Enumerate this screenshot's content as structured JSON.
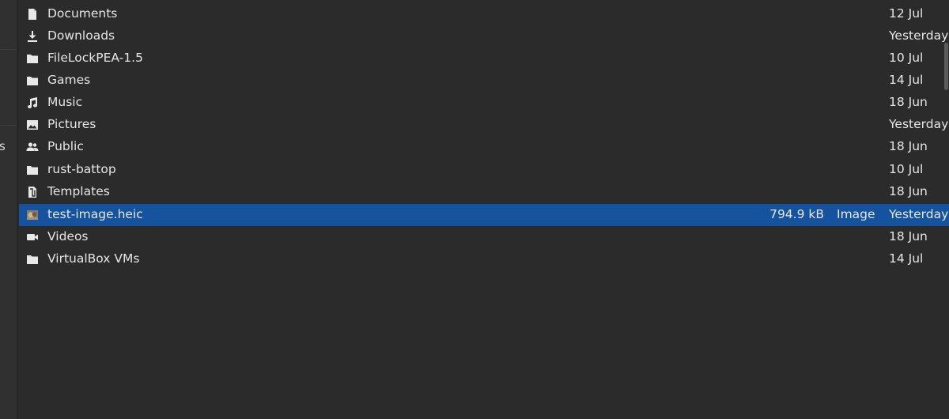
{
  "sidebar": {
    "fragment_label": "s"
  },
  "files": [
    {
      "name": "Documents",
      "size": "",
      "type": "",
      "modified": "12 Jul",
      "icon": "document-icon"
    },
    {
      "name": "Downloads",
      "size": "",
      "type": "",
      "modified": "Yesterday",
      "icon": "download-icon"
    },
    {
      "name": "FileLockPEA-1.5",
      "size": "",
      "type": "",
      "modified": "10 Jul",
      "icon": "folder-icon"
    },
    {
      "name": "Games",
      "size": "",
      "type": "",
      "modified": "14 Jul",
      "icon": "folder-icon"
    },
    {
      "name": "Music",
      "size": "",
      "type": "",
      "modified": "18 Jun",
      "icon": "music-icon"
    },
    {
      "name": "Pictures",
      "size": "",
      "type": "",
      "modified": "Yesterday",
      "icon": "pictures-icon"
    },
    {
      "name": "Public",
      "size": "",
      "type": "",
      "modified": "18 Jun",
      "icon": "public-icon"
    },
    {
      "name": "rust-battop",
      "size": "",
      "type": "",
      "modified": "10 Jul",
      "icon": "folder-icon"
    },
    {
      "name": "Templates",
      "size": "",
      "type": "",
      "modified": "18 Jun",
      "icon": "templates-icon"
    },
    {
      "name": "test-image.heic",
      "size": "794.9 kB",
      "type": "Image",
      "modified": "Yesterday",
      "icon": "image-thumbnail-icon",
      "selected": true
    },
    {
      "name": "Videos",
      "size": "",
      "type": "",
      "modified": "18 Jun",
      "icon": "videos-icon"
    },
    {
      "name": "VirtualBox VMs",
      "size": "",
      "type": "",
      "modified": "14 Jul",
      "icon": "folder-icon"
    }
  ],
  "colors": {
    "background": "#2b2b2b",
    "selection": "#15539e",
    "text": "#e6e6e6"
  }
}
